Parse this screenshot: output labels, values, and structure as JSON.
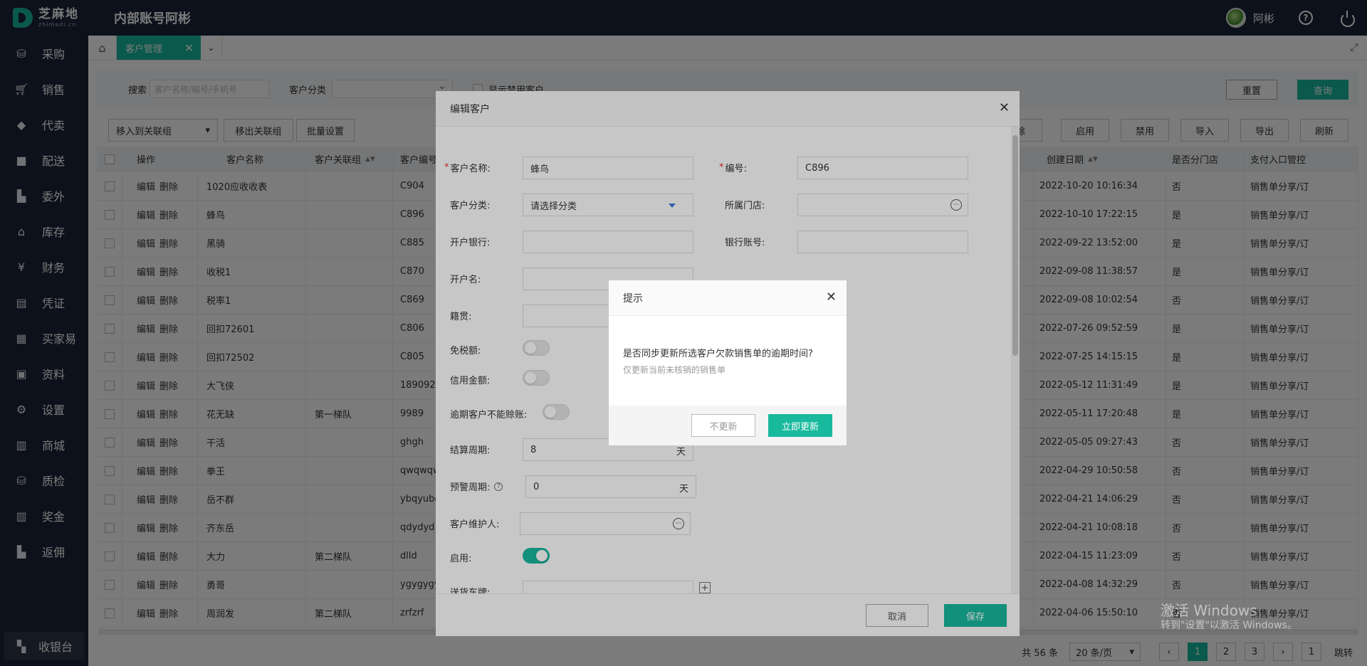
{
  "app": {
    "logo_main": "芝麻地",
    "logo_sub": "zhimadi.cn",
    "account_title": "内部账号阿彬",
    "user_name": "阿彬"
  },
  "sidebar": {
    "items": [
      {
        "label": "采购",
        "icon": "basket-icon"
      },
      {
        "label": "销售",
        "icon": "cart-icon"
      },
      {
        "label": "代卖",
        "icon": "tag-icon"
      },
      {
        "label": "配送",
        "icon": "truck-icon"
      },
      {
        "label": "委外",
        "icon": "building-icon"
      },
      {
        "label": "库存",
        "icon": "warehouse-icon"
      },
      {
        "label": "财务",
        "icon": "yen-icon"
      },
      {
        "label": "凭证",
        "icon": "voucher-icon"
      },
      {
        "label": "买家易",
        "icon": "store-icon"
      },
      {
        "label": "资料",
        "icon": "folder-icon"
      },
      {
        "label": "设置",
        "icon": "gear-icon"
      },
      {
        "label": "商城",
        "icon": "mall-icon"
      },
      {
        "label": "质检",
        "icon": "inspect-icon"
      },
      {
        "label": "奖金",
        "icon": "bonus-icon"
      },
      {
        "label": "返佣",
        "icon": "rebate-icon"
      }
    ],
    "cashier_label": "收银台"
  },
  "tabs": {
    "active": "客户管理"
  },
  "filter": {
    "search_label": "搜索",
    "search_placeholder": "客户名称/编号/手机号",
    "category_label": "客户分类",
    "show_disabled_label": "显示禁用客户",
    "reset_label": "重置",
    "query_label": "查询"
  },
  "toolbar": {
    "move_group": "移入到关联组",
    "remove_group": "移出关联组",
    "batch_set": "批量设置",
    "delete": "删除",
    "enable": "启用",
    "disable": "禁用",
    "import": "导入",
    "export": "导出",
    "refresh": "刷新"
  },
  "table": {
    "headers": {
      "op": "操作",
      "name": "客户名称",
      "group": "客户关联组",
      "code": "客户编号",
      "created": "创建日期",
      "branch": "是否分门店",
      "pay": "支付入口管控"
    },
    "edit_label": "编辑",
    "delete_label": "删除",
    "rows": [
      {
        "name": "1020应收收表",
        "group": "",
        "code": "C904",
        "created": "2022-10-20 10:16:34",
        "branch": "否",
        "pay": "销售单分享/订"
      },
      {
        "name": "蜂鸟",
        "group": "",
        "code": "C896",
        "created": "2022-10-10 17:22:15",
        "branch": "是",
        "pay": "销售单分享/订"
      },
      {
        "name": "黑骑",
        "group": "",
        "code": "C885",
        "created": "2022-09-22 13:52:00",
        "branch": "是",
        "pay": "销售单分享/订"
      },
      {
        "name": "收税1",
        "group": "",
        "code": "C870",
        "created": "2022-09-08 11:38:57",
        "branch": "是",
        "pay": "销售单分享/订"
      },
      {
        "name": "税率1",
        "group": "",
        "code": "C869",
        "created": "2022-09-08 10:02:54",
        "branch": "否",
        "pay": "销售单分享/订"
      },
      {
        "name": "回扣72601",
        "group": "",
        "code": "C806",
        "created": "2022-07-26 09:52:59",
        "branch": "是",
        "pay": "销售单分享/订"
      },
      {
        "name": "回扣72502",
        "group": "",
        "code": "C805",
        "created": "2022-07-25 14:15:15",
        "branch": "是",
        "pay": "销售单分享/订"
      },
      {
        "name": "大飞侠",
        "group": "",
        "code": "1890923",
        "created": "2022-05-12 11:31:49",
        "branch": "是",
        "pay": "销售单分享/订"
      },
      {
        "name": "花无缺",
        "group": "第一梯队",
        "code": "9989",
        "created": "2022-05-11 17:20:48",
        "branch": "是",
        "pay": "销售单分享/订"
      },
      {
        "name": "干活",
        "group": "",
        "code": "ghgh",
        "created": "2022-05-05 09:27:43",
        "branch": "否",
        "pay": "销售单分享/订"
      },
      {
        "name": "拳王",
        "group": "",
        "code": "qwqwqw",
        "created": "2022-04-29 10:50:58",
        "branch": "否",
        "pay": "销售单分享/订"
      },
      {
        "name": "岳不群",
        "group": "",
        "code": "ybqyubc",
        "created": "2022-04-21 14:06:29",
        "branch": "否",
        "pay": "销售单分享/订"
      },
      {
        "name": "齐东岳",
        "group": "",
        "code": "qdydyd",
        "created": "2022-04-21 10:08:18",
        "branch": "否",
        "pay": "销售单分享/订"
      },
      {
        "name": "大力",
        "group": "第二梯队",
        "code": "dlld",
        "created": "2022-04-15 11:23:09",
        "branch": "否",
        "pay": "销售单分享/订"
      },
      {
        "name": "勇哥",
        "group": "",
        "code": "ygygygy",
        "created": "2022-04-08 14:32:29",
        "branch": "否",
        "pay": "销售单分享/订"
      },
      {
        "name": "周润发",
        "group": "第二梯队",
        "code": "zrfzrf",
        "created": "2022-04-06 15:50:10",
        "branch": "否",
        "pay": "销售单分享/订"
      }
    ]
  },
  "pager": {
    "total": "共 56 条",
    "size": "20 条/页",
    "pages": [
      "1",
      "2",
      "3"
    ],
    "jump_value": "1",
    "jump_label": "跳转"
  },
  "edit_dialog": {
    "title": "编辑客户",
    "name_label": "客户名称:",
    "name_value": "蜂鸟",
    "code_label": "编号:",
    "code_value": "C896",
    "category_label": "客户分类:",
    "category_value": "请选择分类",
    "store_label": "所属门店:",
    "bank_label": "开户银行:",
    "account_label": "银行账号:",
    "holder_label": "开户名:",
    "origin_label": "籍贯:",
    "tax_free_label": "免税额:",
    "credit_label": "信用金额:",
    "overdue_label": "逾期客户不能赊账:",
    "settle_label": "结算周期:",
    "settle_value": "8",
    "day_unit": "天",
    "warn_label": "预警周期:",
    "warn_value": "0",
    "keeper_label": "客户维护人:",
    "enabled_label": "启用:",
    "plate_label": "送货车牌:",
    "cancel_label": "取消",
    "save_label": "保存"
  },
  "confirm_dialog": {
    "title": "提示",
    "message": "是否同步更新所选客户欠款销售单的逾期时间?",
    "sub_message": "仅更新当前未核销的销售单",
    "no_label": "不更新",
    "yes_label": "立即更新"
  },
  "watermark": {
    "line1": "激活 Windows",
    "line2": "转到\"设置\"以激活 Windows。"
  },
  "colors": {
    "accent": "#19b99e",
    "navbar": "#1c2539"
  }
}
